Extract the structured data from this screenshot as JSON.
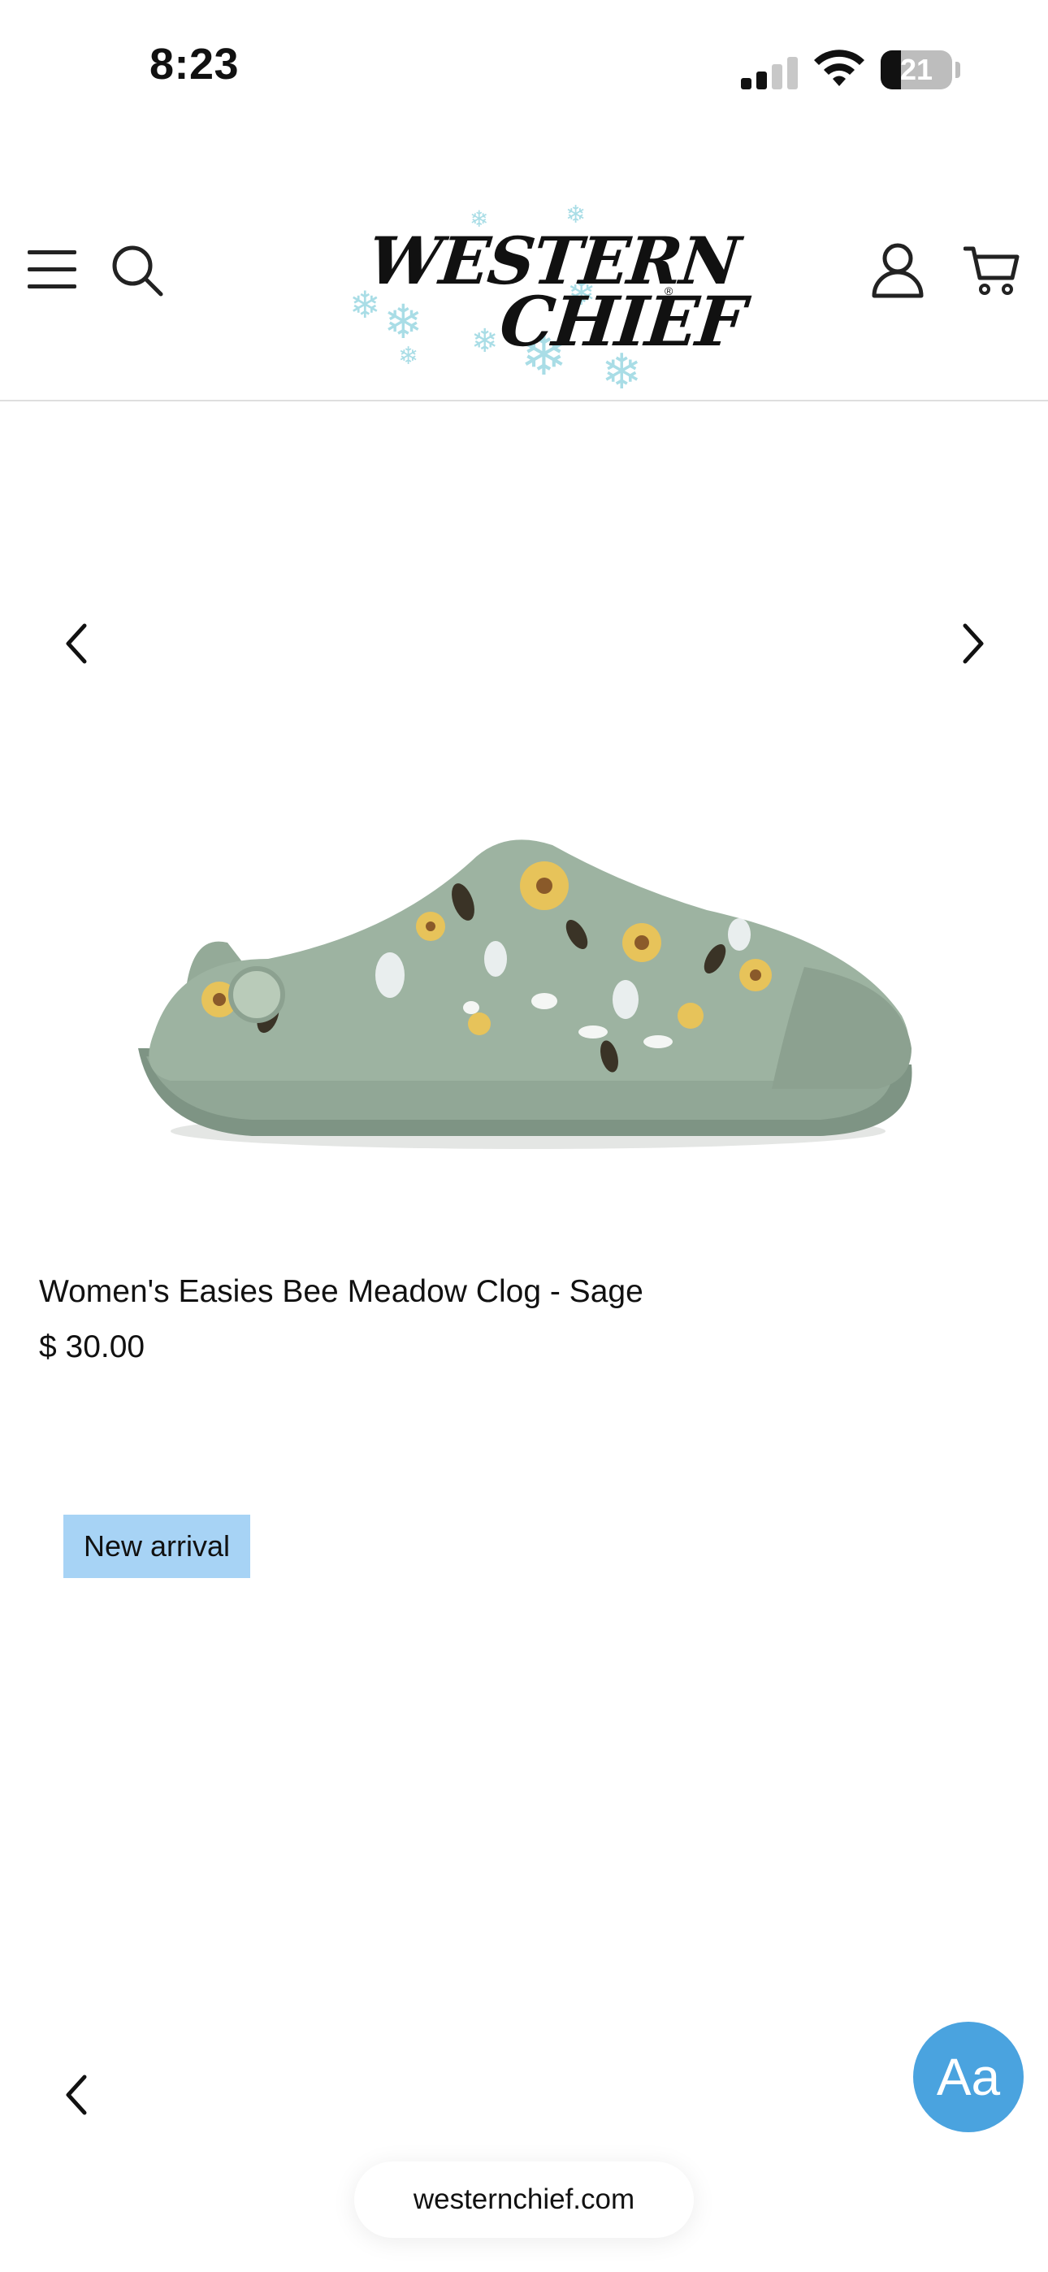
{
  "status_bar": {
    "time": "8:23",
    "battery_level": "21",
    "icons": [
      "signal-icon",
      "wifi-icon",
      "battery-icon"
    ]
  },
  "header": {
    "logo_text_line1": "WESTERN",
    "logo_text_line2": "CHIEF",
    "icons": [
      "menu-icon",
      "search-icon",
      "account-icon",
      "cart-icon"
    ]
  },
  "carousel": {
    "icons": [
      "chevron-left-icon",
      "chevron-right-icon"
    ]
  },
  "product": {
    "title": "Women's Easies Bee Meadow Clog - Sage",
    "price": "$ 30.00",
    "image": "sage-clog-with-bee-and-sunflower-print"
  },
  "badge": {
    "label": "New arrival",
    "color": "#a7d3f5"
  },
  "text_size_button": {
    "label": "Aa",
    "color": "#4aa3df"
  },
  "browser": {
    "url": "westernchief.com"
  }
}
